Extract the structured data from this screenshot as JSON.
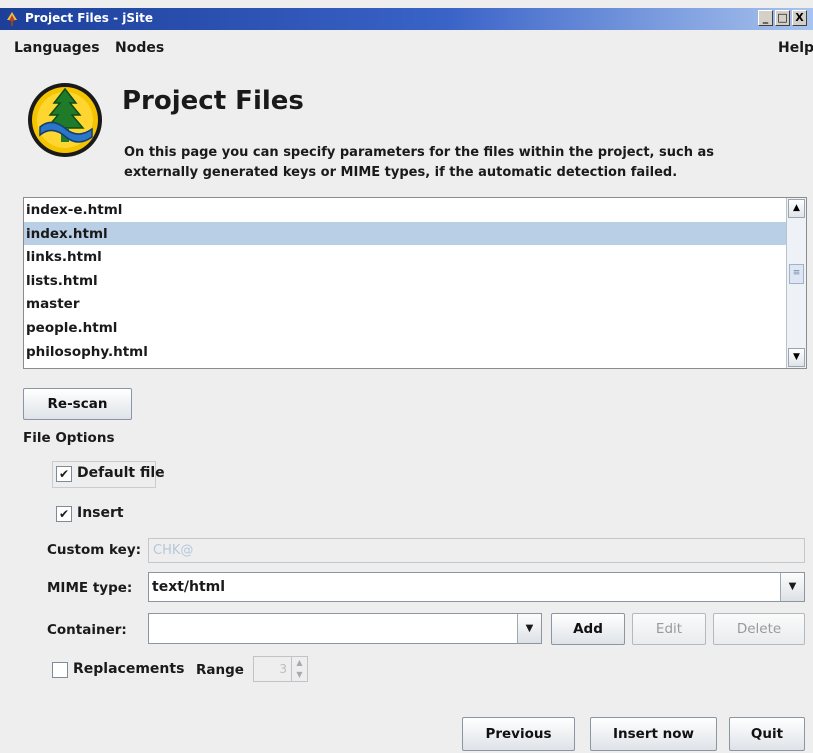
{
  "window": {
    "title": "Project Files - jSite",
    "controls": [
      "_",
      "□",
      "X"
    ]
  },
  "menu": {
    "languages": "Languages",
    "nodes": "Nodes",
    "help": "Help"
  },
  "header": {
    "title": "Project Files",
    "description": "On this page you can specify parameters for the files within the project, such as externally generated keys or MIME types, if the automatic detection failed."
  },
  "files": {
    "items": [
      "index-e.html",
      "index.html",
      "links.html",
      "lists.html",
      "master",
      "people.html",
      "philosophy.html"
    ],
    "selected": "index.html"
  },
  "rescan": {
    "label": "Re-scan"
  },
  "file_options": {
    "label": "File Options",
    "default_file": {
      "label": "Default file",
      "checked": true
    },
    "insert": {
      "label": "Insert",
      "checked": true
    },
    "custom_key": {
      "label": "Custom key:",
      "value": "CHK@"
    },
    "mime_type": {
      "label": "MIME type:",
      "value": "text/html"
    },
    "container": {
      "label": "Container:",
      "value": "",
      "add": "Add",
      "edit": "Edit",
      "delete": "Delete"
    },
    "replacements": {
      "label": "Replacements",
      "checked": false
    },
    "range": {
      "label": "Range",
      "value": "3"
    }
  },
  "footer": {
    "previous": "Previous",
    "insert_now": "Insert now",
    "quit": "Quit"
  },
  "colors": {
    "selection": "#b9cfe6",
    "titlebar": "#1c3f9a",
    "logo_ring": "#f4c400",
    "logo_tree": "#1f7a2a"
  }
}
